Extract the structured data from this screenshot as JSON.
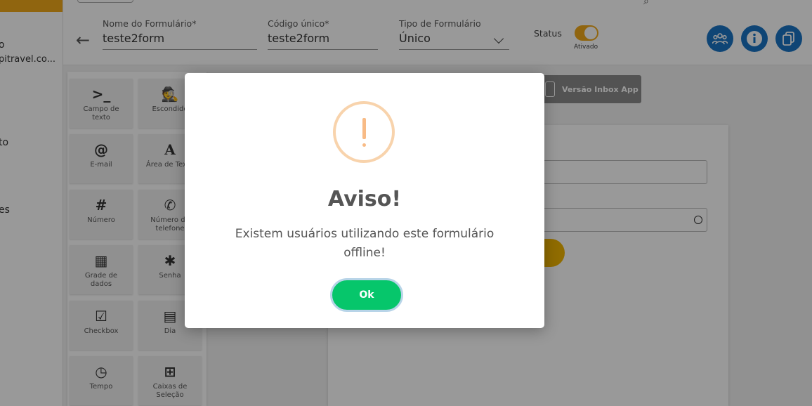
{
  "sidebar": {
    "texts": [
      "o",
      "pitravel.co...",
      "to",
      "es"
    ]
  },
  "header": {
    "form_name": {
      "label": "Nome do Formulário*",
      "value": "teste2form"
    },
    "unique_code": {
      "label": "Código único*",
      "value": "teste2form"
    },
    "form_type": {
      "label": "Tipo de Formulário",
      "value": "Único"
    },
    "status": {
      "label": "Status",
      "toggle_caption": "Ativado",
      "enabled": true
    },
    "icons": [
      "group-icon",
      "info-icon",
      "copy-icon"
    ]
  },
  "palette": {
    "items": [
      {
        "icon": "terminal-icon",
        "glyph": ">_",
        "label_1": "Campo de",
        "label_2": "texto"
      },
      {
        "icon": "spy-icon",
        "glyph": "🕵",
        "label_1": "Escondido",
        "label_2": ""
      },
      {
        "icon": "at-icon",
        "glyph": "@",
        "label_1": "E-mail",
        "label_2": ""
      },
      {
        "icon": "font-icon",
        "glyph": "A",
        "label_1": "Área de Texto",
        "label_2": ""
      },
      {
        "icon": "hash-icon",
        "glyph": "#",
        "label_1": "Número",
        "label_2": ""
      },
      {
        "icon": "phone-icon",
        "glyph": "✆",
        "label_1": "Número de",
        "label_2": "telefone"
      },
      {
        "icon": "grid-icon",
        "glyph": "▦",
        "label_1": "Grade de",
        "label_2": "dados"
      },
      {
        "icon": "asterisk-icon",
        "glyph": "✱",
        "label_1": "Senha",
        "label_2": ""
      },
      {
        "icon": "checkbox-icon",
        "glyph": "☑",
        "label_1": "Checkbox",
        "label_2": ""
      },
      {
        "icon": "calendar-icon",
        "glyph": "▤",
        "label_1": "Dia",
        "label_2": ""
      },
      {
        "icon": "clock-icon",
        "glyph": "◷",
        "label_1": "Tempo",
        "label_2": ""
      },
      {
        "icon": "plus-box-icon",
        "glyph": "⊞",
        "label_1": "Caixas de",
        "label_2": "Seleção"
      }
    ]
  },
  "preview": {
    "inbox_button": "Versão Inbox App"
  },
  "modal": {
    "title": "Aviso!",
    "message": "Existem usuários utilizando este formulário offline!",
    "ok_label": "Ok",
    "icon": "exclamation-icon"
  },
  "colors": {
    "accent": "#f0a81a",
    "primary_blue": "#1a74c4",
    "ok_green": "#06c66b",
    "warning": "#f8bb86"
  }
}
